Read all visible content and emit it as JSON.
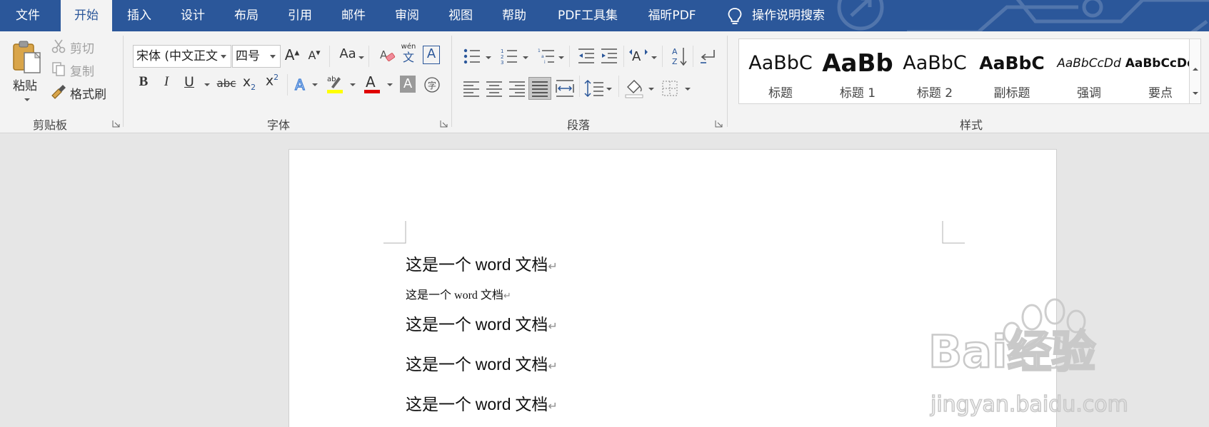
{
  "tabs": [
    {
      "label": "文件",
      "active": false
    },
    {
      "label": "开始",
      "active": true
    },
    {
      "label": "插入",
      "active": false
    },
    {
      "label": "设计",
      "active": false
    },
    {
      "label": "布局",
      "active": false
    },
    {
      "label": "引用",
      "active": false
    },
    {
      "label": "邮件",
      "active": false
    },
    {
      "label": "审阅",
      "active": false
    },
    {
      "label": "视图",
      "active": false
    },
    {
      "label": "帮助",
      "active": false
    },
    {
      "label": "PDF工具集",
      "active": false
    },
    {
      "label": "福昕PDF",
      "active": false
    }
  ],
  "tell_me": {
    "label": "操作说明搜索",
    "icon": "lightbulb-icon"
  },
  "clipboard": {
    "group_label": "剪贴板",
    "paste": "粘贴",
    "cut": "剪切",
    "copy": "复制",
    "format_painter": "格式刷"
  },
  "font": {
    "group_label": "字体",
    "font_name": "宋体 (中文正文",
    "font_size": "四号",
    "change_case": "Aa",
    "phonetic_top": "wén",
    "phonetic_bottom": "文",
    "boxed": "A",
    "bold": "B",
    "italic": "I",
    "underline": "U",
    "strikethrough": "abc",
    "grow": "A",
    "shrink": "A",
    "highlight_color": "#ffff00",
    "font_color": "#e00000"
  },
  "paragraph": {
    "group_label": "段落"
  },
  "styles": {
    "group_label": "样式",
    "items": [
      {
        "sample": "AaBbC",
        "name": "标题"
      },
      {
        "sample": "AaBb",
        "name": "标题 1"
      },
      {
        "sample": "AaBbC",
        "name": "标题 2"
      },
      {
        "sample": "AaBbC",
        "name": "副标题"
      },
      {
        "sample": "AaBbCcDd",
        "name": "强调"
      },
      {
        "sample": "AaBbCcDd",
        "name": "要点"
      }
    ]
  },
  "document": {
    "lines": [
      {
        "cn1": "这是一个 ",
        "en": "word",
        "cn2": " 文档",
        "mark": "↵"
      },
      {
        "cn1": "这是一个 ",
        "en": "word",
        "cn2": " 文档",
        "mark": "↵"
      },
      {
        "cn1": "这是一个 ",
        "en": "word",
        "cn2": " 文档",
        "mark": "↵"
      },
      {
        "cn1": "这是一个 ",
        "en": "word",
        "cn2": " 文档",
        "mark": "↵"
      },
      {
        "cn1": "这是一个 ",
        "en": "word",
        "cn2": " 文档",
        "mark": "↵"
      }
    ]
  },
  "watermark": {
    "brand": "Bai经验",
    "url": "jingyan.baidu.com"
  },
  "colors": {
    "ribbon_blue": "#2b579a",
    "ribbon_bg": "#f3f3f3",
    "workspace": "#e6e6e6"
  }
}
